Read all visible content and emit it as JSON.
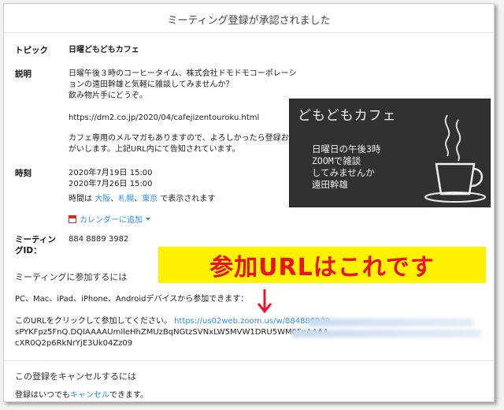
{
  "header": {
    "title": "ミーティング登録が承認されました"
  },
  "topic": {
    "label": "トピック",
    "value": "日曜どもどもカフェ"
  },
  "description": {
    "label": "説明",
    "line1": "日曜午後３時のコーヒータイム、株式会社ドモドモコーポレーシ",
    "line2": "ョンの遠田幹雄と気軽に雑談してみませんか？",
    "line3": "飲み物片手にどうぞ。",
    "url": "https://dm2.co.jp/2020/04/cafejizentouroku.html",
    "line4": "カフェ専用のメルマガもありますので、よろしかったら登録おね",
    "line5": "がいします。上記URL内にて告知されています。"
  },
  "time": {
    "label": "時刻",
    "date1": "2020年7月19日 15:00",
    "date2": "2020年7月26日 15:00",
    "tz_prefix": "時間は",
    "tz_osaka": "大阪",
    "tz_sep1": "、",
    "tz_sapporo": "札幌",
    "tz_sep2": "、",
    "tz_tokyo": "東京",
    "tz_suffix": "で表示されます",
    "calendar_label": "カレンダーに追加"
  },
  "meeting": {
    "label_line1": "ミーティン",
    "label_line2": "グID：",
    "id": "884 8889 3982"
  },
  "join": {
    "heading": "ミーティングに参加するには",
    "devices": "PC、Mac、iPad、iPhone、Androidデバイスから参加できます：",
    "click_text": "このURLをクリックして参加してください。",
    "url_line1": "https://us02web.zoom.us/w/884888939",
    "url_line2": "sPYKFpz5FnQ.DQIAAAAUmlleHhZMUzBqNGtzSVNxLW5MVW1DRU5WM0FnAAAA",
    "url_line3": "cXR0Q2p6RkNrYjE3Uk04Zz09"
  },
  "cancel": {
    "heading": "この登録をキャンセルするには",
    "prefix": "登録はいつでも",
    "link": "キャンセル",
    "suffix": "できます。"
  },
  "image": {
    "title": "どもどもカフェ",
    "line1": "日曜日の午後3時",
    "line2": "ZOOMで雑談",
    "line3": "してみませんか",
    "line4": "遠田幹雄"
  },
  "annotation": {
    "banner": "参加URLはこれです"
  },
  "colors": {
    "link": "#2d8cff",
    "banner_bg": "#fff200",
    "banner_text": "#e8132a",
    "blackboard": "#2f3330"
  }
}
